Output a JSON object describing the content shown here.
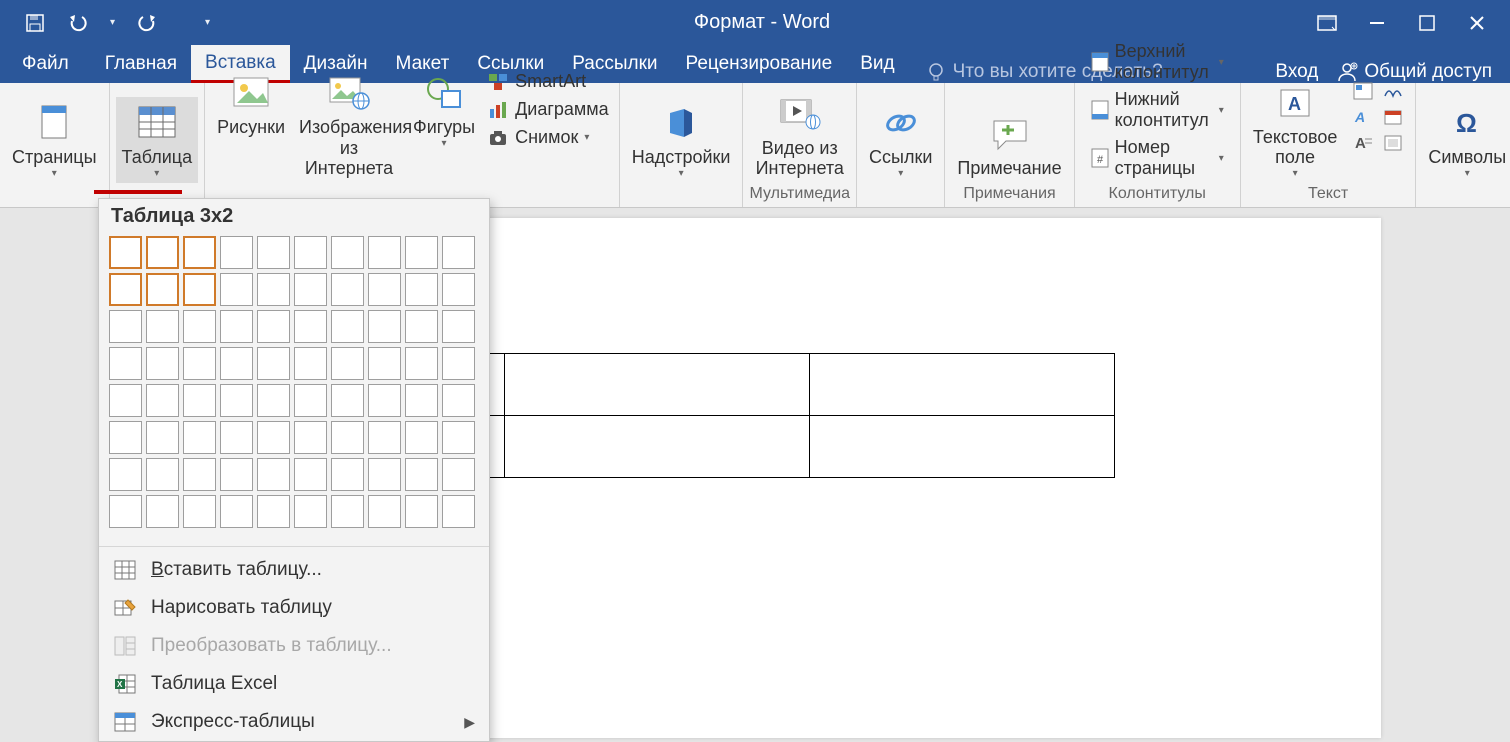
{
  "title": "Формат - Word",
  "qat": {
    "save": "save",
    "undo": "undo",
    "redo": "redo"
  },
  "window_controls": {
    "ribbon_opts": "ribbon-options",
    "min": "minimize",
    "max": "maximize",
    "close": "close"
  },
  "tabs": {
    "file": "Файл",
    "home": "Главная",
    "insert": "Вставка",
    "design": "Дизайн",
    "layout": "Макет",
    "references": "Ссылки",
    "mailings": "Рассылки",
    "review": "Рецензирование",
    "view": "Вид"
  },
  "active_tab": "insert",
  "tellme_placeholder": "Что вы хотите сделать?",
  "account": {
    "login": "Вход",
    "share": "Общий доступ"
  },
  "ribbon": {
    "pages": {
      "label": "Страницы"
    },
    "table": {
      "label": "Таблица"
    },
    "illustrations": {
      "pictures": "Рисунки",
      "online_pictures": "Изображения из Интернета",
      "shapes": "Фигуры",
      "smartart": "SmartArt",
      "chart": "Диаграмма",
      "screenshot": "Снимок"
    },
    "addins": {
      "label": "Надстройки"
    },
    "media": {
      "online_video": "Видео из Интернета",
      "group": "Мультимедиа"
    },
    "links": {
      "label": "Ссылки"
    },
    "comments": {
      "comment": "Примечание",
      "group": "Примечания"
    },
    "headerfooter": {
      "header": "Верхний колонтитул",
      "footer": "Нижний колонтитул",
      "page_number": "Номер страницы",
      "group": "Колонтитулы"
    },
    "text": {
      "textbox": "Текстовое поле",
      "group": "Текст"
    },
    "symbols": {
      "label": "Символы"
    }
  },
  "table_menu": {
    "header": "Таблица 3x2",
    "grid_cols": 10,
    "grid_rows": 8,
    "highlight_cols": 3,
    "highlight_rows": 2,
    "items": {
      "insert": "Вставить таблицу...",
      "draw": "Нарисовать таблицу",
      "convert": "Преобразовать в таблицу...",
      "excel": "Таблица Excel",
      "quick": "Экспресс-таблицы"
    },
    "convert_enabled": false
  },
  "document": {
    "table_preview": {
      "cols": 3,
      "rows": 2
    }
  }
}
